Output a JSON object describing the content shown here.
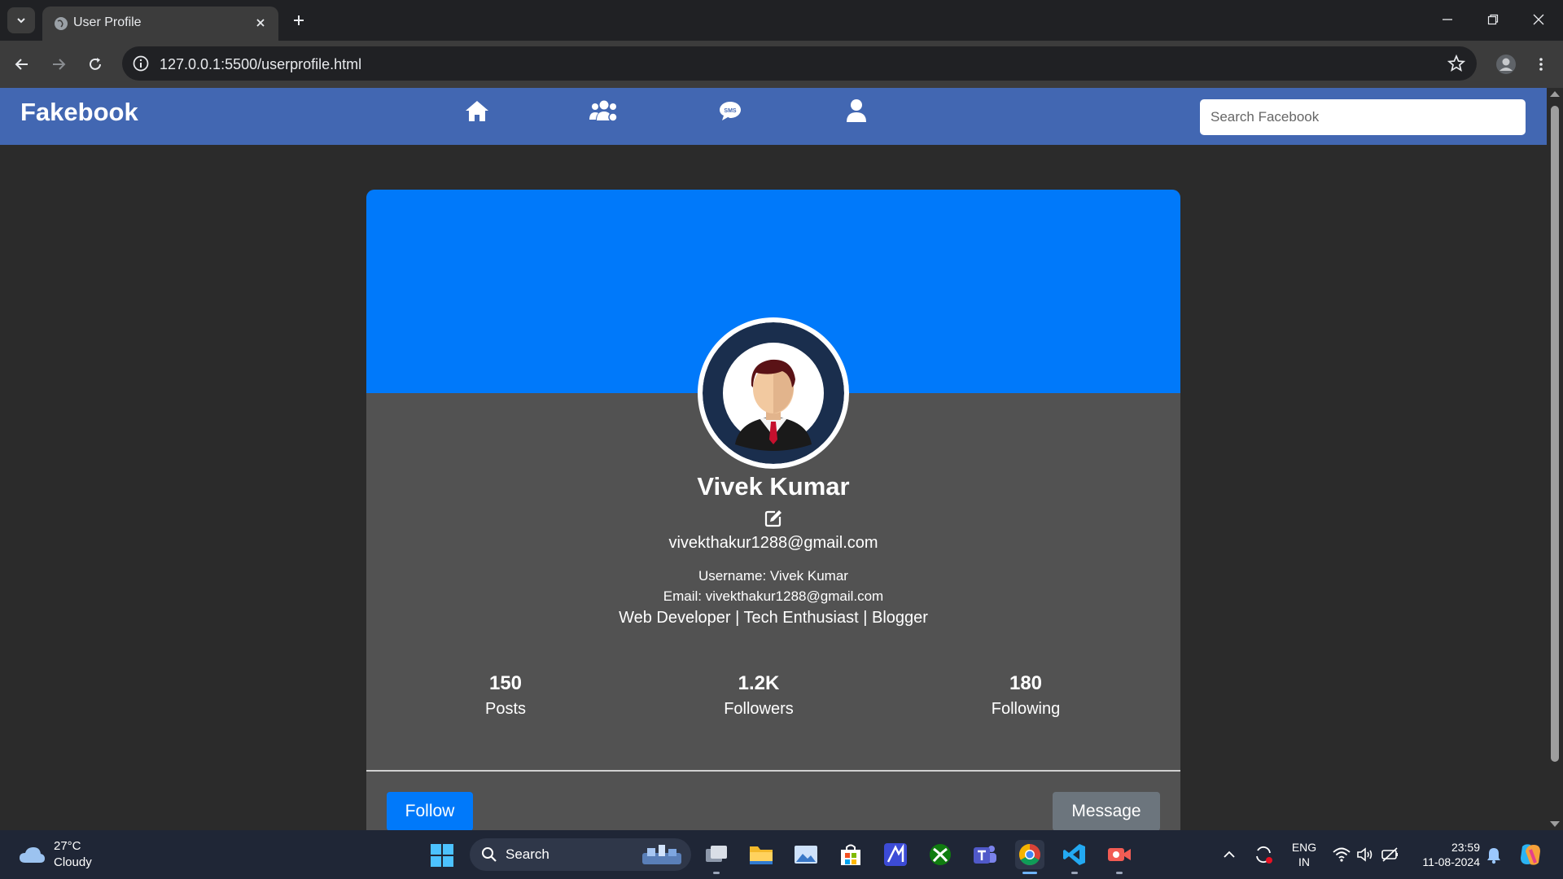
{
  "browser": {
    "tab_title": "User Profile",
    "url": "127.0.0.1:5500/userprofile.html"
  },
  "nav": {
    "logo": "Fakebook",
    "icons": [
      "home-icon",
      "friends-icon",
      "messages-icon",
      "profile-icon"
    ],
    "search_placeholder": "Search Facebook",
    "color": "#4267b2"
  },
  "profile": {
    "name": "Vivek Kumar",
    "email": "vivekthakur1288@gmail.com",
    "username_line": "Username: Vivek Kumar",
    "email_line": "Email: vivekthakur1288@gmail.com",
    "bio": "Web Developer | Tech Enthusiast | Blogger",
    "cover_color": "#0079fa",
    "stats": [
      {
        "value": "150",
        "label": "Posts"
      },
      {
        "value": "1.2K",
        "label": "Followers"
      },
      {
        "value": "180",
        "label": "Following"
      }
    ],
    "follow_label": "Follow",
    "message_label": "Message"
  },
  "taskbar": {
    "weather_temp": "27°C",
    "weather_desc": "Cloudy",
    "search_label": "Search",
    "lang_top": "ENG",
    "lang_bottom": "IN",
    "time": "23:59",
    "date": "11-08-2024"
  }
}
